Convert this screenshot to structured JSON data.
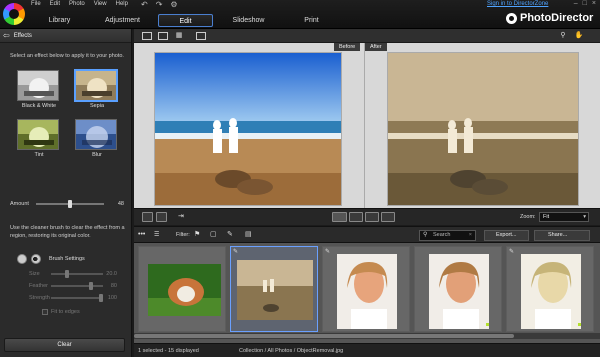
{
  "menu": [
    "File",
    "Edit",
    "Photo",
    "View",
    "Help"
  ],
  "tabs": [
    {
      "label": "Library",
      "active": false
    },
    {
      "label": "Adjustment",
      "active": false
    },
    {
      "label": "Edit",
      "active": true
    },
    {
      "label": "Slideshow",
      "active": false
    },
    {
      "label": "Print",
      "active": false
    }
  ],
  "signin_text": "Sign in to DirectorZone",
  "brand_name": "PhotoDirector",
  "left_panel": {
    "title": "Effects",
    "intro": "Select an effect below to apply it to your photo.",
    "effects": [
      {
        "label": "Black & White",
        "selected": false
      },
      {
        "label": "Sepia",
        "selected": true
      },
      {
        "label": "Tint",
        "selected": false
      },
      {
        "label": "Blur",
        "selected": false
      }
    ],
    "amount_label": "Amount",
    "amount_value": "48",
    "cleaner_text": "Use the cleaner brush to clear the effect from a region, restoring its original color.",
    "brush_settings_label": "Brush Settings",
    "params": [
      {
        "label": "Size",
        "value": "20.0"
      },
      {
        "label": "Feather",
        "value": "80"
      },
      {
        "label": "Strength",
        "value": "100"
      }
    ],
    "fit_to_edges_label": "Fit to edges",
    "clear_label": "Clear"
  },
  "viewer": {
    "before_label": "Before",
    "after_label": "After"
  },
  "zoom": {
    "label": "Zoom:",
    "value": "Fit"
  },
  "filter": {
    "label": "Filter:",
    "search_placeholder": "Search",
    "export_label": "Export...",
    "share_label": "Share..."
  },
  "status": {
    "count_text": "1 selected - 15 displayed",
    "path_text": "Collection / All Photos / ObjectRemoval.jpg"
  },
  "colors": {
    "accent": "#4a7fd0",
    "link": "#4fa3ff",
    "selection": "#6aa0ff"
  }
}
